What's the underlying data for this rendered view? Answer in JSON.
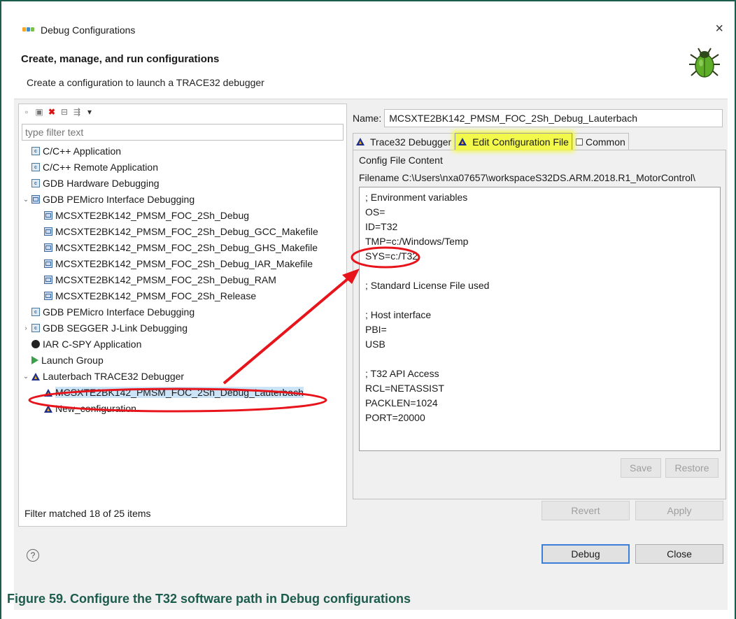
{
  "window": {
    "title": "Debug Configurations",
    "close_glyph": "×",
    "header_title": "Create, manage, and run configurations",
    "header_subtitle": "Create a configuration to launch a TRACE32 debugger"
  },
  "left_panel": {
    "filter_placeholder": "type filter text",
    "status": "Filter matched 18 of 25 items",
    "tree": [
      {
        "label": "C/C++ Application",
        "icon": "c-app-icon",
        "level": 1,
        "twisty": ""
      },
      {
        "label": "C/C++ Remote Application",
        "icon": "c-app-icon",
        "level": 1,
        "twisty": ""
      },
      {
        "label": "GDB Hardware Debugging",
        "icon": "c-app-icon",
        "level": 1,
        "twisty": ""
      },
      {
        "label": "GDB PEMicro Interface Debugging",
        "icon": "pemicro-icon",
        "level": 1,
        "twisty": "⌄"
      },
      {
        "label": "MCSXTE2BK142_PMSM_FOC_2Sh_Debug",
        "icon": "pemicro-icon",
        "level": 2,
        "twisty": ""
      },
      {
        "label": "MCSXTE2BK142_PMSM_FOC_2Sh_Debug_GCC_Makefile",
        "icon": "pemicro-icon",
        "level": 2,
        "twisty": ""
      },
      {
        "label": "MCSXTE2BK142_PMSM_FOC_2Sh_Debug_GHS_Makefile",
        "icon": "pemicro-icon",
        "level": 2,
        "twisty": ""
      },
      {
        "label": "MCSXTE2BK142_PMSM_FOC_2Sh_Debug_IAR_Makefile",
        "icon": "pemicro-icon",
        "level": 2,
        "twisty": ""
      },
      {
        "label": "MCSXTE2BK142_PMSM_FOC_2Sh_Debug_RAM",
        "icon": "pemicro-icon",
        "level": 2,
        "twisty": ""
      },
      {
        "label": "MCSXTE2BK142_PMSM_FOC_2Sh_Release",
        "icon": "pemicro-icon",
        "level": 2,
        "twisty": ""
      },
      {
        "label": "GDB PEMicro Interface Debugging",
        "icon": "c-app-icon",
        "level": 1,
        "twisty": ""
      },
      {
        "label": "GDB SEGGER J-Link Debugging",
        "icon": "c-app-icon",
        "level": 1,
        "twisty": "›"
      },
      {
        "label": "IAR C-SPY Application",
        "icon": "iar-icon",
        "level": 1,
        "twisty": ""
      },
      {
        "label": "Launch Group",
        "icon": "launch-group-icon",
        "level": 1,
        "twisty": ""
      },
      {
        "label": "Lauterbach TRACE32 Debugger",
        "icon": "trace32-icon",
        "level": 1,
        "twisty": "⌄"
      },
      {
        "label": "MCSXTE2BK142_PMSM_FOC_2Sh_Debug_Lauterbach",
        "icon": "trace32-icon",
        "level": 2,
        "twisty": "",
        "selected": true
      },
      {
        "label": "New_configuration",
        "icon": "trace32-icon",
        "level": 2,
        "twisty": ""
      }
    ]
  },
  "right_panel": {
    "name_label": "Name:",
    "name_value": "MCSXTE2BK142_PMSM_FOC_2Sh_Debug_Lauterbach",
    "tabs": [
      {
        "label": "Trace32 Debugger",
        "icon": "trace32-icon"
      },
      {
        "label": "Edit Configuration File",
        "icon": "trace32-icon",
        "active": true
      },
      {
        "label": "Common",
        "icon": "common-icon"
      }
    ],
    "config_title": "Config File Content",
    "filename": "Filename  C:\\Users\\nxa07657\\workspaceS32DS.ARM.2018.R1_MotorControl\\",
    "content_lines": [
      "; Environment variables",
      "OS=",
      "ID=T32",
      "TMP=c:/Windows/Temp",
      "SYS=c:/T32",
      "",
      "; Standard License File used",
      "",
      "; Host interface",
      "PBI=",
      "USB",
      "",
      "; T32 API Access",
      "RCL=NETASSIST",
      "PACKLEN=1024",
      "PORT=20000"
    ],
    "save_label": "Save",
    "restore_label": "Restore",
    "revert_label": "Revert",
    "apply_label": "Apply"
  },
  "footer": {
    "help_glyph": "?",
    "debug_label": "Debug",
    "close_label": "Close"
  },
  "annotation": {
    "color": "#e8141c",
    "highlight_color": "#f3f94a"
  },
  "caption": "Figure 59. Configure the T32 software path in Debug configurations"
}
